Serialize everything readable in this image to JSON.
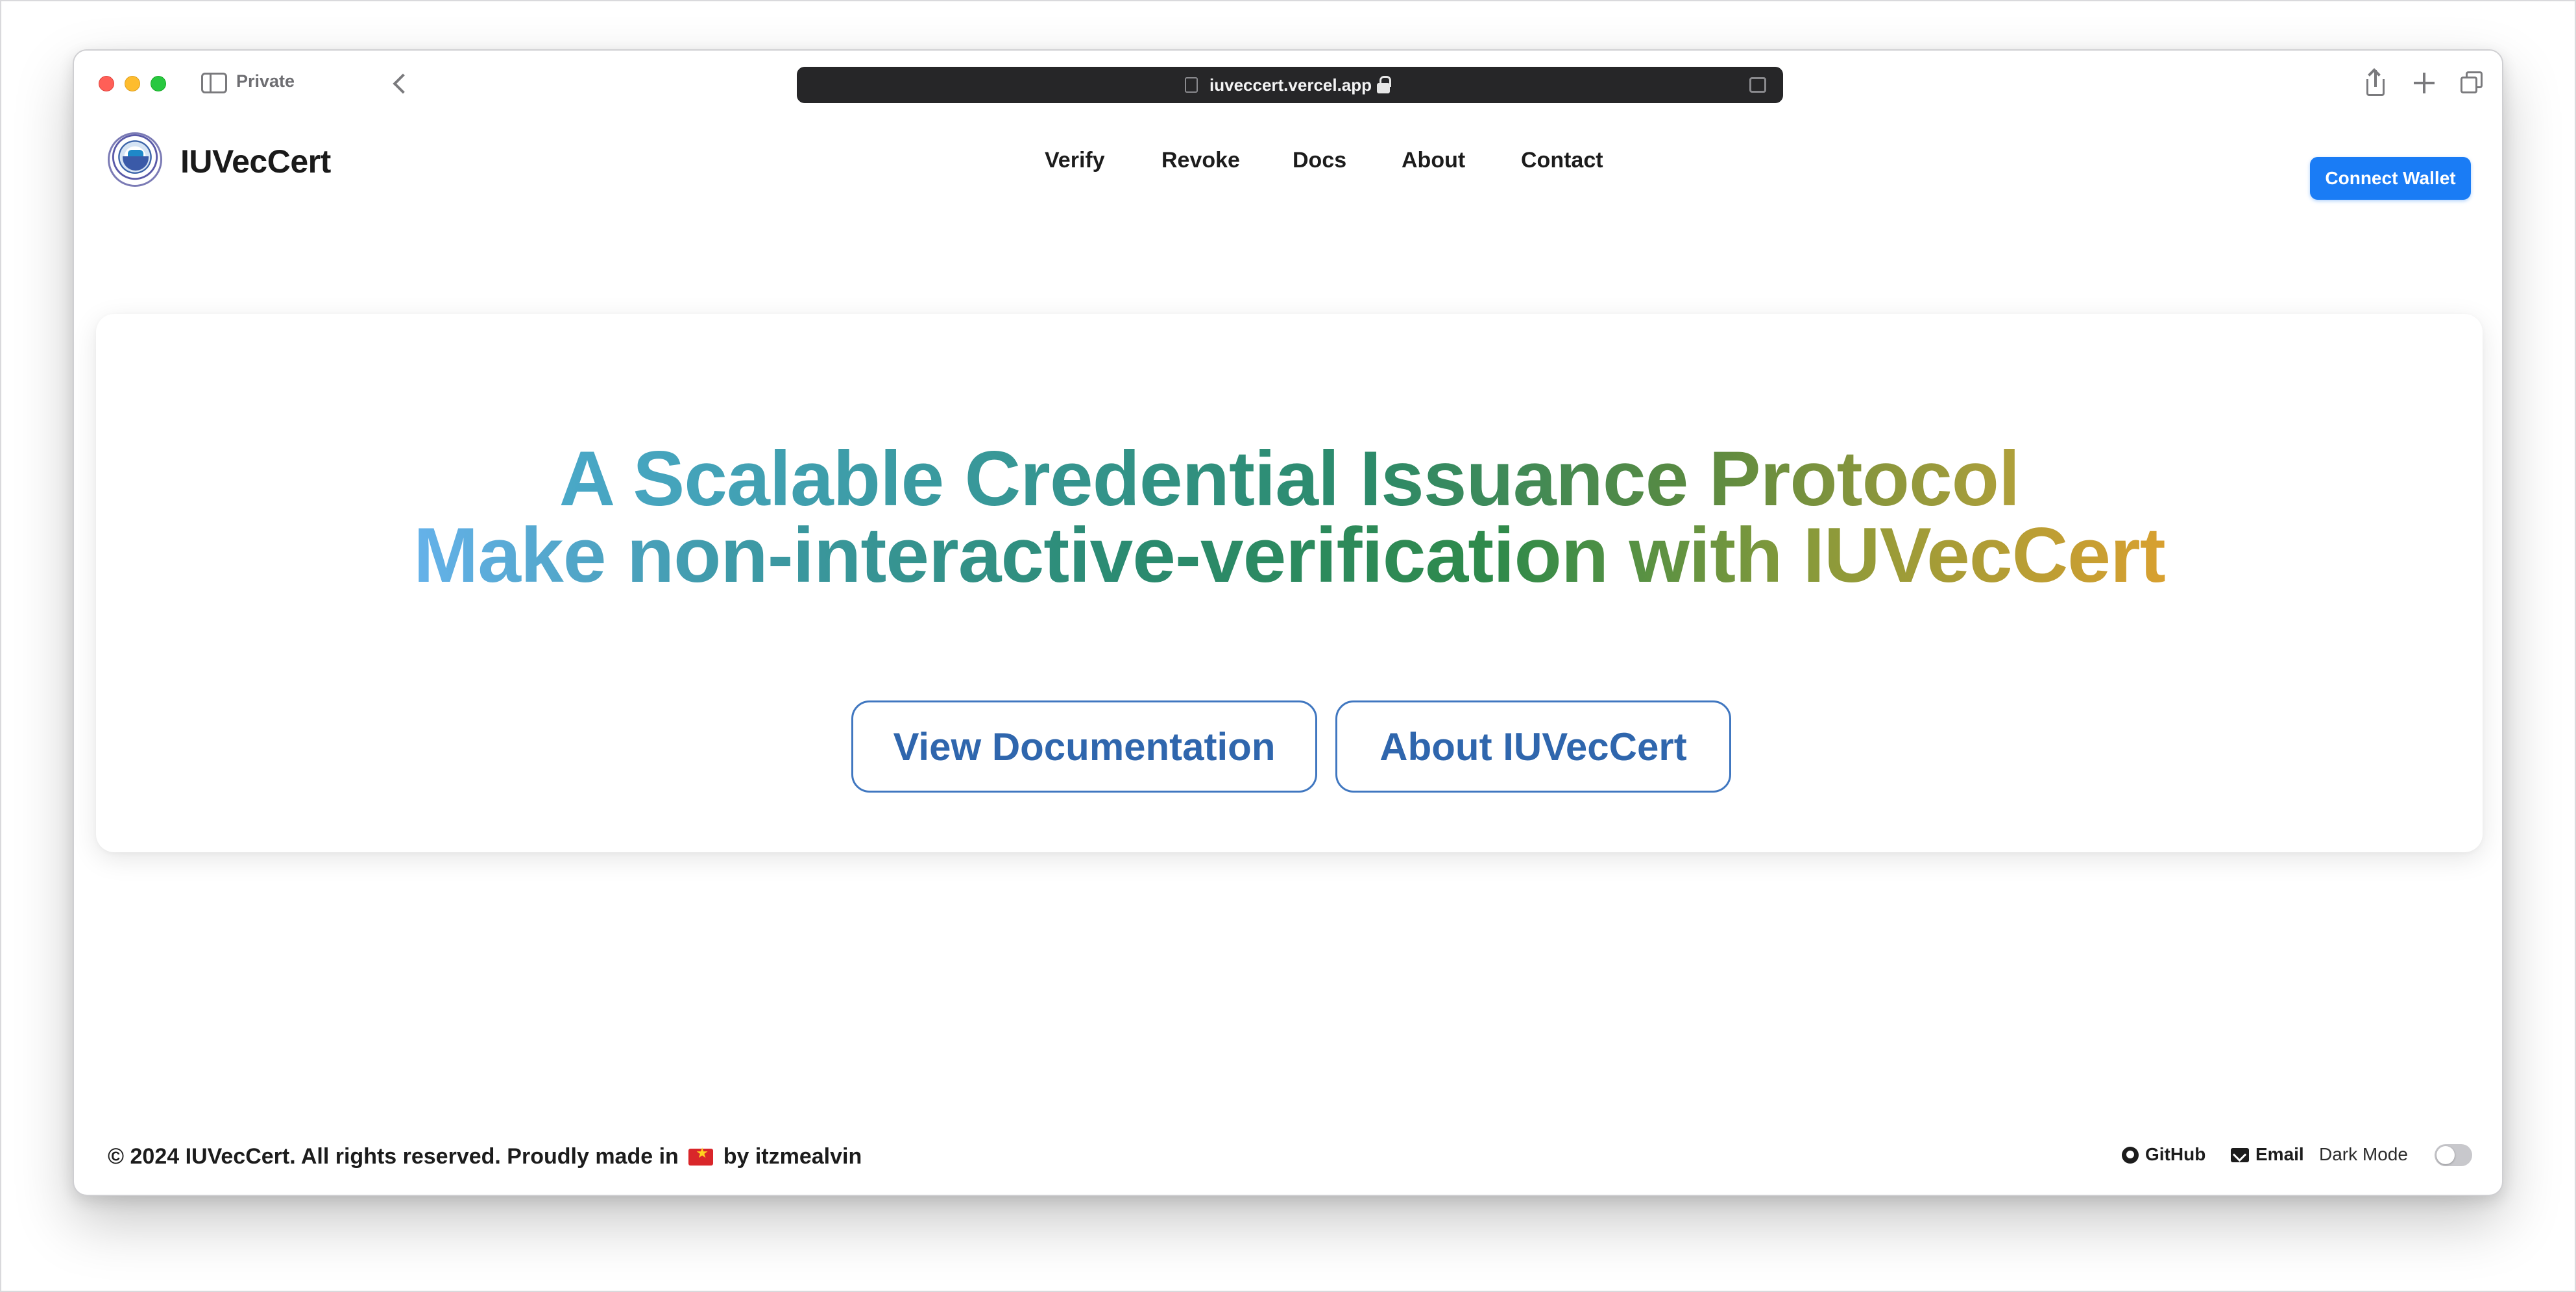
{
  "browser": {
    "private_label": "Private",
    "url": "iuveccert.vercel.app"
  },
  "site": {
    "brand": "IUVecCert",
    "nav": [
      "Verify",
      "Revoke",
      "Docs",
      "About",
      "Contact"
    ],
    "connect_wallet": "Connect Wallet"
  },
  "hero": {
    "line1": "A Scalable Credential Issuance Protocol",
    "line2": "Make non-interactive-verification with IUVecCert",
    "buttons": {
      "docs": "View Documentation",
      "about": "About IUVecCert"
    }
  },
  "footer": {
    "copyright_prefix": "© 2024 IUVecCert. All rights reserved. Proudly made in",
    "copyright_suffix": "by itzmealvin",
    "github": "GitHub",
    "email": "Email",
    "dark_mode": "Dark Mode",
    "dark_mode_enabled": false
  },
  "colors": {
    "accent": "#1a7cf5",
    "outline_button": "#4077c0",
    "gradient_start": "#65b2ea",
    "gradient_mid": "#2a8a6e",
    "gradient_end": "#d8a030"
  }
}
